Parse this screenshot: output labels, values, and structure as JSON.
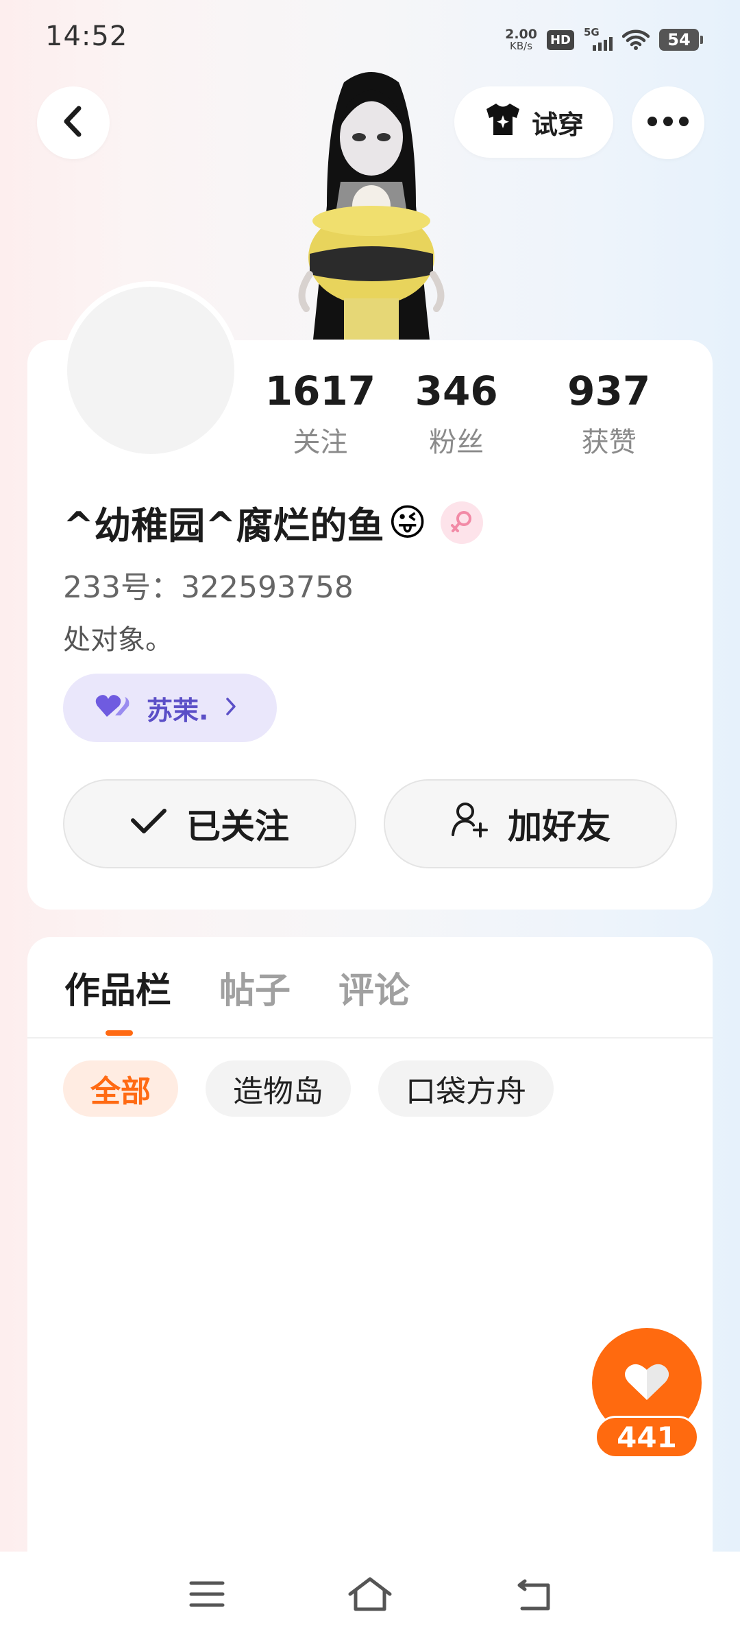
{
  "status_bar": {
    "time": "14:52",
    "net_speed_value": "2.00",
    "net_speed_unit": "KB/s",
    "hd_label": "HD",
    "network_label": "5G",
    "battery_level": "54",
    "icons": [
      "hd-icon",
      "signal-icon",
      "wifi-icon",
      "battery-icon"
    ]
  },
  "header": {
    "back_icon": "chevron-left-icon",
    "try_on_label": "试穿",
    "try_on_icon": "shirt-icon",
    "more_icon": "more-icon"
  },
  "profile": {
    "stats": [
      {
        "value": "1617",
        "label": "关注"
      },
      {
        "value": "346",
        "label": "粉丝"
      },
      {
        "value": "937",
        "label": "获赞"
      }
    ],
    "nickname": "^幼稚园^腐烂的鱼",
    "nickname_emoji": "😜",
    "gender_icon": "female-icon",
    "uid": "233号：322593758",
    "bio": "处对象。",
    "cp_tag": {
      "name": "苏茉.",
      "icon": "heart-pair-icon"
    },
    "follow_button": "已关注",
    "add_friend_button": "加好友"
  },
  "content": {
    "tabs": [
      {
        "label": "作品栏",
        "active": true
      },
      {
        "label": "帖子",
        "active": false
      },
      {
        "label": "评论",
        "active": false
      }
    ],
    "filters": [
      {
        "label": "全部",
        "active": true
      },
      {
        "label": "造物岛",
        "active": false
      },
      {
        "label": "口袋方舟",
        "active": false
      }
    ]
  },
  "like": {
    "count": "441",
    "icon": "heart-icon"
  },
  "nav_bar": {
    "icons": [
      "menu-icon",
      "home-icon",
      "back-nav-icon"
    ]
  },
  "colors": {
    "accent": "#ff6a13",
    "cp_tag_bg": "#eae7fb",
    "cp_tag_text": "#5b4fc7"
  }
}
